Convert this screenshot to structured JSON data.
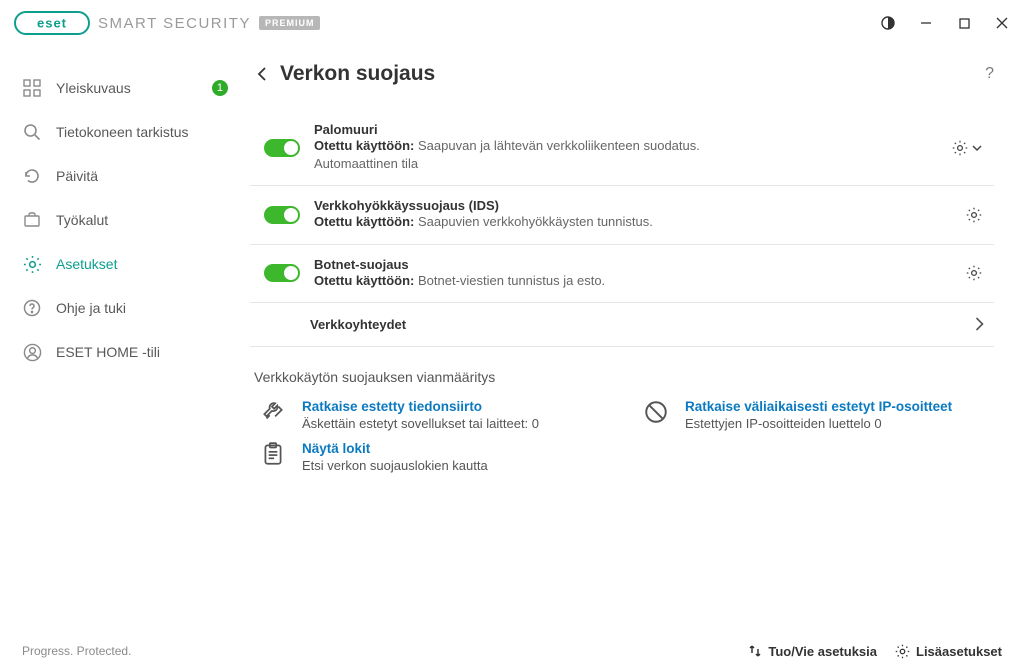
{
  "header": {
    "brand": "eset",
    "product": "SMART SECURITY",
    "badge": "PREMIUM"
  },
  "sidebar": {
    "items": [
      {
        "label": "Yleiskuvaus",
        "badge": "1"
      },
      {
        "label": "Tietokoneen tarkistus"
      },
      {
        "label": "Päivitä"
      },
      {
        "label": "Työkalut"
      },
      {
        "label": "Asetukset"
      },
      {
        "label": "Ohje ja tuki"
      },
      {
        "label": "ESET HOME -tili"
      }
    ]
  },
  "main": {
    "title": "Verkon suojaus",
    "modules": [
      {
        "title": "Palomuuri",
        "enabled_prefix": "Otettu käyttöön:",
        "desc": " Saapuvan ja lähtevän verkkoliikenteen suodatus.",
        "line2": "Automaattinen tila",
        "has_chevron": true
      },
      {
        "title": "Verkkohyökkäyssuojaus (IDS)",
        "enabled_prefix": "Otettu käyttöön:",
        "desc": " Saapuvien verkkohyökkäysten tunnistus.",
        "has_chevron": false
      },
      {
        "title": "Botnet-suojaus",
        "enabled_prefix": "Otettu käyttöön:",
        "desc": " Botnet-viestien tunnistus ja esto.",
        "has_chevron": false
      }
    ],
    "connections_label": "Verkkoyhteydet",
    "ts_heading": "Verkkokäytön suojauksen vianmääritys",
    "ts": [
      {
        "link": "Ratkaise estetty tiedonsiirto",
        "desc": "Äskettäin estetyt sovellukset tai laitteet: 0"
      },
      {
        "link": "Ratkaise väliaikaisesti estetyt IP-osoitteet",
        "desc": "Estettyjen IP-osoitteiden luettelo 0"
      },
      {
        "link": "Näytä lokit",
        "desc": "Etsi verkon suojauslokien kautta"
      }
    ]
  },
  "footer": {
    "tagline": "Progress. Protected.",
    "import_export": "Tuo/Vie asetuksia",
    "advanced": "Lisäasetukset"
  }
}
